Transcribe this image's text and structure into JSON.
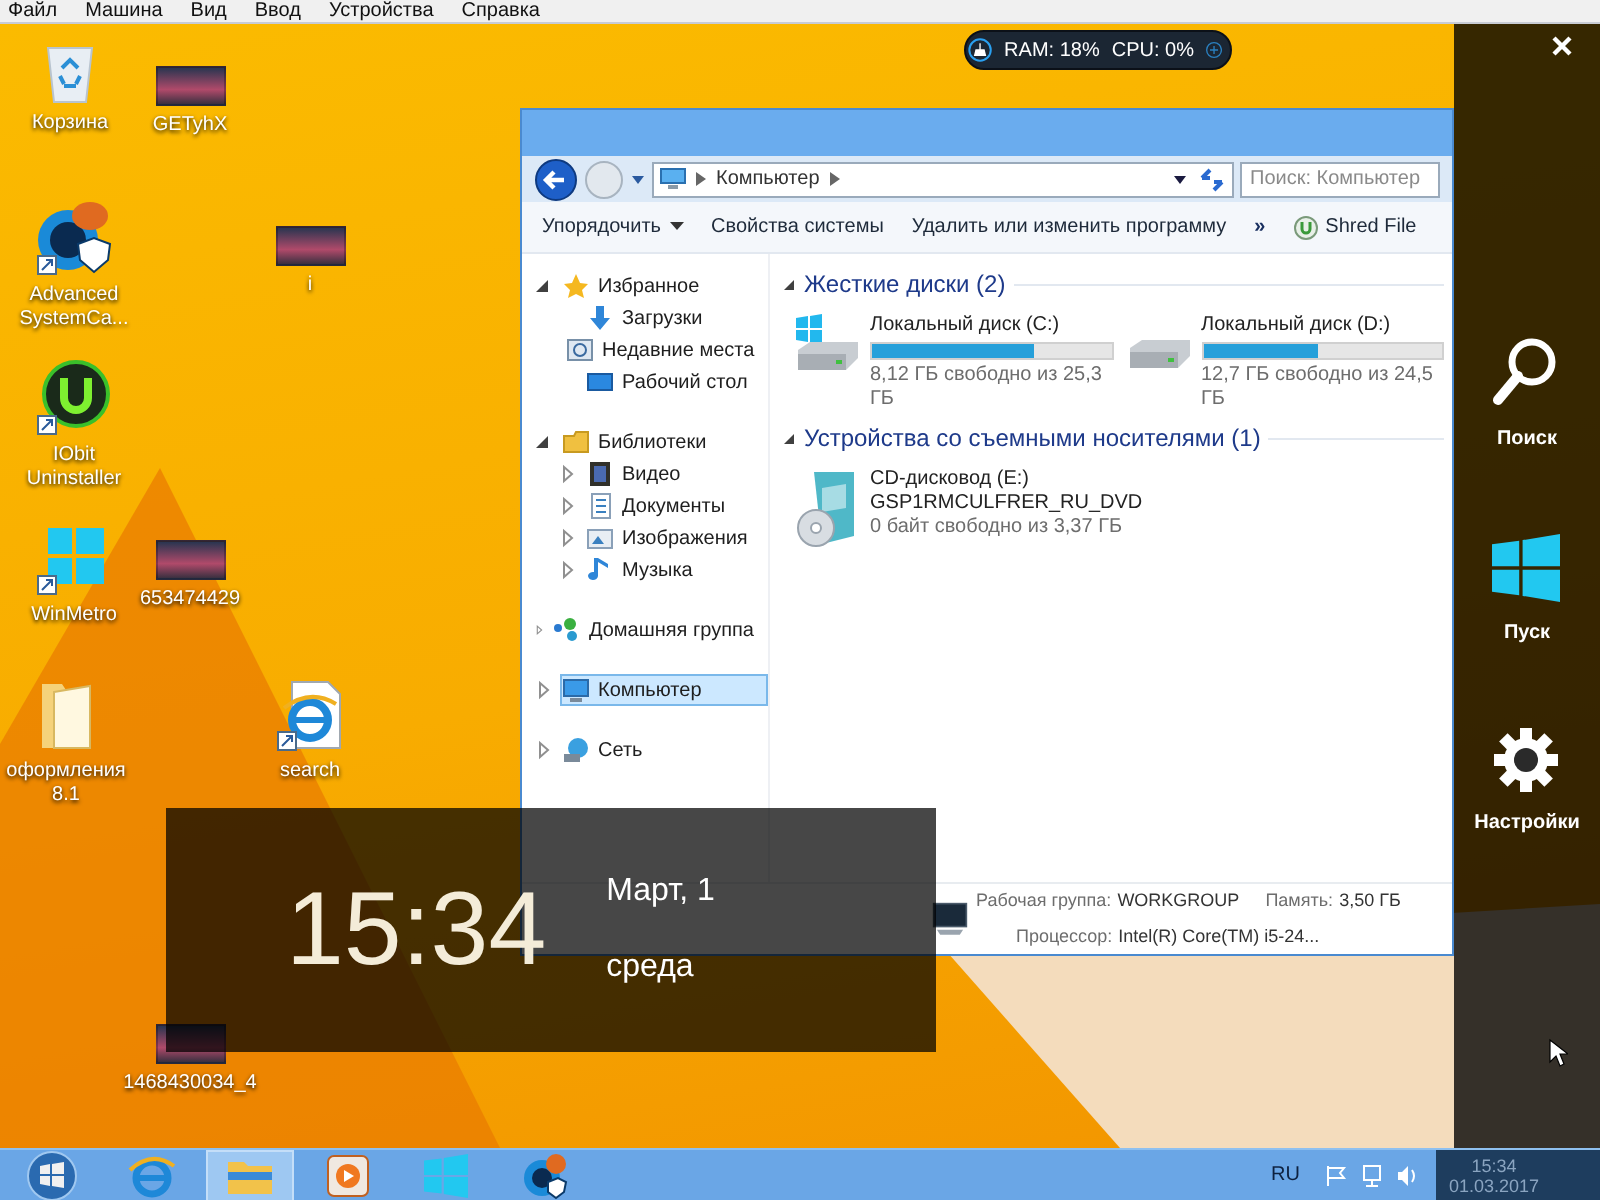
{
  "menu_bar": [
    "Файл",
    "Машина",
    "Вид",
    "Ввод",
    "Устройства",
    "Справка"
  ],
  "desktop_icons": [
    {
      "kind": "recycle-bin",
      "label": "Корзина"
    },
    {
      "kind": "photo",
      "label": "GETyhX"
    },
    {
      "kind": "cleaner-app",
      "label": "Advanced SystemCa..."
    },
    {
      "kind": "photo",
      "label": "i"
    },
    {
      "kind": "uninstaller-app",
      "label": "IObit Uninstaller"
    },
    {
      "kind": "windows-app",
      "label": "WinMetro"
    },
    {
      "kind": "photo",
      "label": "653474429"
    },
    {
      "kind": "folder",
      "label": "оформления 8.1"
    },
    {
      "kind": "browser-shortcut",
      "label": "search"
    },
    {
      "kind": "photo",
      "label": "1468430034_4"
    }
  ],
  "system_monitor": {
    "ram": "RAM: 18%",
    "cpu": "CPU: 0%"
  },
  "explorer": {
    "address": "Компьютер",
    "search": {
      "placeholder": "Поиск: Компьютер"
    },
    "toolbar": [
      {
        "kind": "menu",
        "label": "Упорядочить"
      },
      {
        "kind": "button",
        "label": "Свойства системы"
      },
      {
        "kind": "button",
        "label": "Удалить или изменить программу"
      },
      {
        "kind": "more",
        "label": "»"
      },
      {
        "kind": "shred",
        "label": "Shred File"
      }
    ],
    "nav": [
      {
        "label": "Избранное",
        "kind": "star",
        "expanded": true,
        "selected": false,
        "children": [
          {
            "label": "Загрузки",
            "kind": "download",
            "selected": false
          },
          {
            "label": "Недавние места",
            "kind": "recent",
            "selected": false
          },
          {
            "label": "Рабочий стол",
            "kind": "desktop",
            "selected": false
          }
        ]
      },
      {
        "label": "Библиотеки",
        "kind": "library",
        "expanded": true,
        "selected": false,
        "children": [
          {
            "label": "Видео",
            "kind": "video",
            "expanded": false,
            "selected": false
          },
          {
            "label": "Документы",
            "kind": "documents",
            "expanded": false,
            "selected": false
          },
          {
            "label": "Изображения",
            "kind": "pictures",
            "expanded": false,
            "selected": false
          },
          {
            "label": "Музыка",
            "kind": "music",
            "expanded": false,
            "selected": false
          }
        ]
      },
      {
        "label": "Домашняя группа",
        "kind": "homegroup",
        "expanded": false,
        "selected": false
      },
      {
        "label": "Компьютер",
        "kind": "computer",
        "expanded": false,
        "selected": true
      },
      {
        "label": "Сеть",
        "kind": "network",
        "expanded": false,
        "selected": false
      }
    ],
    "sections": [
      {
        "title": "Жесткие диски (2)",
        "items": [
          {
            "kind": "system-disk",
            "name": "Локальный диск (C:)",
            "level": 0.68,
            "info": "8,12 ГБ свободно из 25,3 ГБ"
          },
          {
            "kind": "disk",
            "name": "Локальный диск (D:)",
            "level": 0.48,
            "info": "12,7 ГБ свободно из 24,5 ГБ"
          }
        ]
      },
      {
        "title": "Устройства со съемными носителями (1)",
        "items": [
          {
            "kind": "cd",
            "name": "CD-дисковод (E:)",
            "volume": "GSP1RMCULFRER_RU_DVD",
            "info": "0 байт свободно из 3,37 ГБ"
          }
        ]
      }
    ],
    "details": [
      {
        "label": "Рабочая группа:",
        "value": "WORKGROUP"
      },
      {
        "label": "Память:",
        "value": "3,50 ГБ"
      },
      {
        "label": "Процессор:",
        "value": "Intel(R) Core(TM) i5-24..."
      }
    ]
  },
  "clock_overlay": {
    "time": "15:34",
    "date": "Март, 1",
    "weekday": "среда"
  },
  "charms": [
    {
      "kind": "search",
      "label": "Поиск"
    },
    {
      "kind": "start",
      "label": "Пуск"
    },
    {
      "kind": "settings",
      "label": "Настройки"
    }
  ],
  "taskbar": {
    "apps": [
      {
        "kind": "browser",
        "selected": false
      },
      {
        "kind": "explorer",
        "selected": true
      },
      {
        "kind": "media",
        "selected": false
      },
      {
        "kind": "windows-app",
        "selected": false
      },
      {
        "kind": "cleaner-app",
        "selected": false
      }
    ],
    "language": "RU",
    "time": "15:34",
    "date": "01.03.2017"
  }
}
